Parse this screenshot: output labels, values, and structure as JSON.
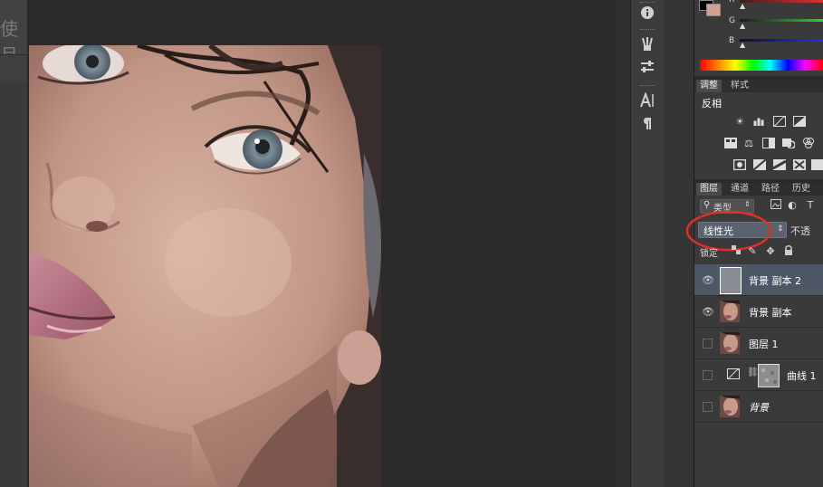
{
  "document": {
    "title_fragment": "使月"
  },
  "color_panel": {
    "channels": [
      {
        "label": "R",
        "color": "#e03030"
      },
      {
        "label": "G",
        "color": "#30c030"
      },
      {
        "label": "B",
        "color": "#3040e0"
      }
    ],
    "foreground_color": "#000000",
    "background_color": "#d4a096"
  },
  "adjustments_panel": {
    "tabs": [
      {
        "label": "调整",
        "active": true
      },
      {
        "label": "样式",
        "active": false
      }
    ],
    "current_label": "反相",
    "icon_rows": [
      [
        "brightness-icon",
        "levels-icon",
        "curves-icon",
        "exposure-icon"
      ],
      [
        "vibrance-icon",
        "color-balance-icon",
        "black-white-icon",
        "photo-filter-icon",
        "channel-mixer-icon"
      ],
      [
        "invert-icon",
        "posterize-icon",
        "threshold-icon",
        "selective-color-icon",
        "gradient-map-icon"
      ]
    ]
  },
  "layers_panel": {
    "tabs": [
      {
        "label": "图层",
        "active": true
      },
      {
        "label": "通道",
        "active": false
      },
      {
        "label": "路径",
        "active": false
      },
      {
        "label": "历史",
        "active": false
      }
    ],
    "filter_kind": "类型",
    "blend_mode": "线性光",
    "opacity_label": "不透",
    "lock_label": "锁定",
    "layers": [
      {
        "name": "背景 副本 2",
        "visible": true,
        "selected": true,
        "thumb": "gray"
      },
      {
        "name": "背景 副本",
        "visible": true,
        "selected": false,
        "thumb": "face"
      },
      {
        "name": "图层 1",
        "visible": false,
        "selected": false,
        "thumb": "face"
      },
      {
        "name": "曲线 1",
        "visible": false,
        "selected": false,
        "thumb": "mask",
        "adjustment": true
      },
      {
        "name": "背景",
        "visible": false,
        "selected": false,
        "thumb": "face",
        "italic": true
      }
    ]
  }
}
